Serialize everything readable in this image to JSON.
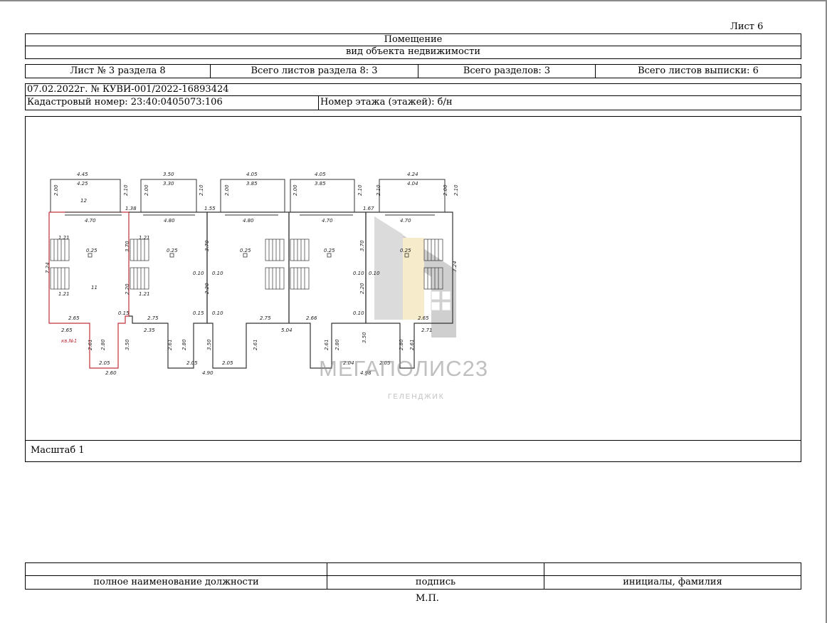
{
  "sheet_label": "Лист 6",
  "header": {
    "title": "Помещение",
    "subtitle": "вид объекта недвижимости",
    "info": [
      "Лист № 3 раздела 8",
      "Всего листов раздела 8: 3",
      "Всего разделов: 3",
      "Всего листов выписки: 6"
    ],
    "doc_ref": "07.02.2022г. № КУВИ-001/2022-16893424",
    "cadastral": "Кадастровый номер: 23:40:0405073:106",
    "floor": "Номер этажа (этажей): б/н"
  },
  "plan": {
    "top_dims": [
      "4.45",
      "3.50",
      "4.05",
      "4.05",
      "4.24"
    ],
    "balcony_dims": [
      "4.25",
      "3.30",
      "3.85",
      "3.85",
      "4.04"
    ],
    "gap_dims": [
      "1.38",
      "1.55",
      "1.67"
    ],
    "unit_widths": [
      "4.70",
      "4.80",
      "4.80",
      "4.70",
      "4.70"
    ],
    "bottom_dims": [
      "2.60",
      "4.90",
      "4.98"
    ],
    "room_labels": [
      "12",
      "11"
    ],
    "unit_marker": "кв.№1",
    "height_dims": [
      "7.24",
      "7.24"
    ],
    "labels": {
      "d121": "1.21",
      "d090": "0.90",
      "d370": "3.70",
      "d025": "0.25",
      "d010": "0.10",
      "d220": "2.20",
      "d015": "0.15",
      "d265": "2.65",
      "d275": "2.75",
      "d266": "2.66",
      "d235": "2.35",
      "d261": "2.61",
      "d280": "2.80",
      "d350": "3.50",
      "d205": "2.05",
      "d275b": "2.75",
      "d504": "5.04",
      "d204": "2.04",
      "d271": "2.71",
      "d200": "2.00",
      "d210": "2.10"
    }
  },
  "scale": "Масштаб 1",
  "signature": {
    "position": "полное наименование должности",
    "sign": "подпись",
    "name": "инициалы, фамилия",
    "stamp": "М.П."
  },
  "watermark": {
    "brand": "МЕГАПОЛИС23",
    "city": "ГЕЛЕНДЖИК"
  }
}
